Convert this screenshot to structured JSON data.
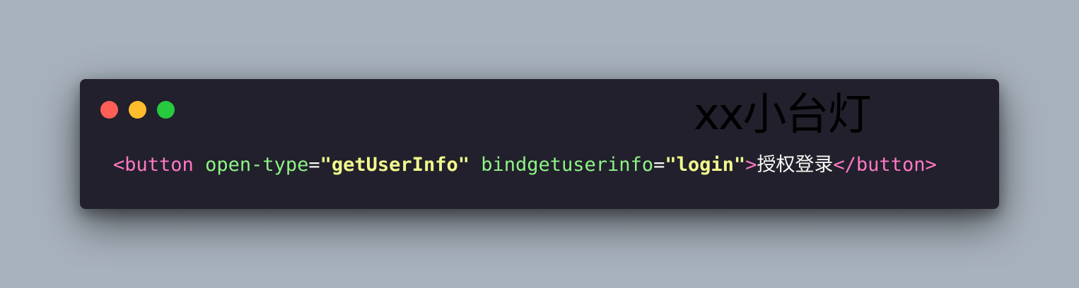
{
  "window": {
    "controls": {
      "close_color": "#ff5f56",
      "minimize_color": "#ffbd2e",
      "maximize_color": "#27c93f"
    },
    "watermark": "xx小台灯",
    "code": {
      "open_tag": "<button",
      "attr1_name": "open-type",
      "eq1": "=",
      "attr1_value": "\"getUserInfo\"",
      "attr2_name": "bindgetuserinfo",
      "eq2": "=",
      "attr2_value": "\"login\"",
      "tag_close": ">",
      "inner_text": "授权登录",
      "close_tag": "</button>"
    }
  }
}
